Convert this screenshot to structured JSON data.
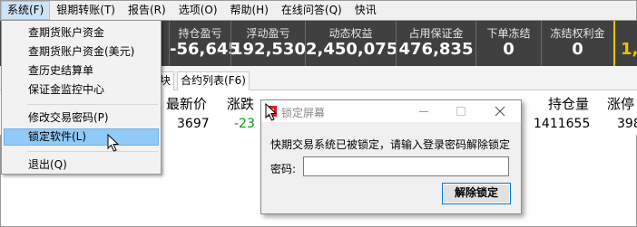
{
  "menubar": {
    "items": [
      {
        "label": "系统(F)"
      },
      {
        "label": "银期转账(T)"
      },
      {
        "label": "报告(R)"
      },
      {
        "label": "选项(O)"
      },
      {
        "label": "帮助(H)"
      },
      {
        "label": "在线问答(Q)"
      },
      {
        "label": "快讯"
      }
    ]
  },
  "system_menu": {
    "items": [
      {
        "label": "查期货账户资金"
      },
      {
        "label": "查期货账户资金(美元)"
      },
      {
        "label": "查历史结算单"
      },
      {
        "label": "保证金监控中心"
      },
      {
        "label": "修改交易密码(P)"
      },
      {
        "label": "锁定软件(L)"
      },
      {
        "label": "退出(Q)"
      }
    ]
  },
  "stats": [
    {
      "label": "持仓盈亏",
      "value": "-56,645"
    },
    {
      "label": "浮动盈亏",
      "value": "192,530"
    },
    {
      "label": "动态权益",
      "value": "2,450,075"
    },
    {
      "label": "占用保证金",
      "value": "476,835"
    },
    {
      "label": "下单冻结",
      "value": "0"
    },
    {
      "label": "冻结权利金",
      "value": "0"
    },
    {
      "label": "",
      "value": "1,"
    }
  ],
  "tabs": [
    {
      "label": "块"
    },
    {
      "label": "合约列表(F6)"
    }
  ],
  "quote_table": {
    "headers": [
      "最新价",
      "涨跌",
      "持仓量",
      "涨停"
    ],
    "row": [
      "3697",
      "-23",
      "1411655",
      "398"
    ]
  },
  "lock_dialog": {
    "title": "锁定屏幕",
    "message": "快期交易系统已被锁定，请输入登录密码解除锁定",
    "password_label": "密码:",
    "password_value": "",
    "unlock_label": "解除锁定"
  },
  "colors": {
    "stats_bg": "#404040",
    "highlight": "#91c9f7",
    "negative": "#0a9a0a",
    "accent_yellow": "#f0c000"
  }
}
